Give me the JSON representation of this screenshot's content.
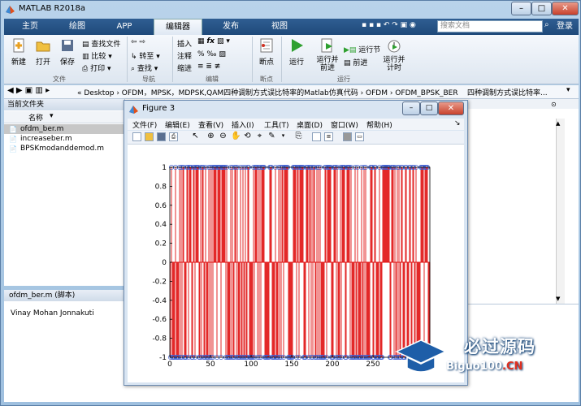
{
  "window": {
    "title": "MATLAB R2018a"
  },
  "tabs": [
    {
      "label": "主页"
    },
    {
      "label": "绘图"
    },
    {
      "label": "APP"
    },
    {
      "label": "编辑器"
    },
    {
      "label": "发布"
    },
    {
      "label": "视图"
    }
  ],
  "search": {
    "placeholder": "搜索文档"
  },
  "login": "登录",
  "ribbon": {
    "new": "新建",
    "open": "打开",
    "save": "保存",
    "find_files": "查找文件",
    "compare": "比较",
    "print": "打印",
    "goto": "转至",
    "find": "查找",
    "insert": "插入",
    "comment": "注释",
    "indent": "缩进",
    "breakpoints": "断点",
    "run": "运行",
    "run_advance": "运行并\n前进",
    "run_section": "运行节",
    "advance": "前进",
    "run_time": "运行并\n计时",
    "groups": {
      "file": "文件",
      "nav": "导航",
      "edit": "编辑",
      "bp": "断点",
      "run": "运行"
    }
  },
  "address": {
    "path": "«  Desktop  ›  OFDM，MPSK，MDPSK,QAM四种调制方式误比特率的Matlab仿真代码  ›  OFDM  ›  OFDM_BPSK_BER",
    "right_text": "四种调制方式误比特率..."
  },
  "left_panel": {
    "title": "当前文件夹",
    "col": "名称",
    "files": [
      "ofdm_ber.m",
      "increaseber.m",
      "BPSKmodanddemod.m"
    ],
    "details_title": "ofdm_ber.m  (脚本)",
    "details_text": "Vinay Mohan Jonnakuti"
  },
  "figure": {
    "title": "Figure 3",
    "menu": [
      "文件(F)",
      "编辑(E)",
      "查看(V)",
      "插入(I)",
      "工具(T)",
      "桌面(D)",
      "窗口(W)",
      "帮助(H)"
    ]
  },
  "chart_data": {
    "type": "line",
    "title": "",
    "xlabel": "",
    "ylabel": "",
    "xlim": [
      0,
      320
    ],
    "ylim": [
      -1,
      1
    ],
    "xticks": [
      0,
      50,
      100,
      150,
      200,
      250,
      300
    ],
    "yticks": [
      -1,
      -0.8,
      -0.6,
      -0.4,
      -0.2,
      0,
      0.2,
      0.4,
      0.6,
      0.8,
      1
    ],
    "xtick_labels": [
      "0",
      "50",
      "100",
      "150",
      "200",
      "250",
      "300"
    ],
    "ytick_labels": [
      "-1",
      "-0.8",
      "-0.6",
      "-0.4",
      "-0.2",
      "0",
      "0.2",
      "0.4",
      "0.6",
      "0.8",
      "1"
    ],
    "series": [
      {
        "style": "stem",
        "color": "#e01010",
        "marker": "o",
        "marker_color": "#4060d0",
        "x_start": 1,
        "x_end": 320,
        "values_hint": "random binary sequence of +1 / -1 stems across x = 1..320"
      }
    ]
  },
  "watermark": {
    "title": "必过源码",
    "url": "Biguo100",
    "url_suffix": ".CN"
  }
}
